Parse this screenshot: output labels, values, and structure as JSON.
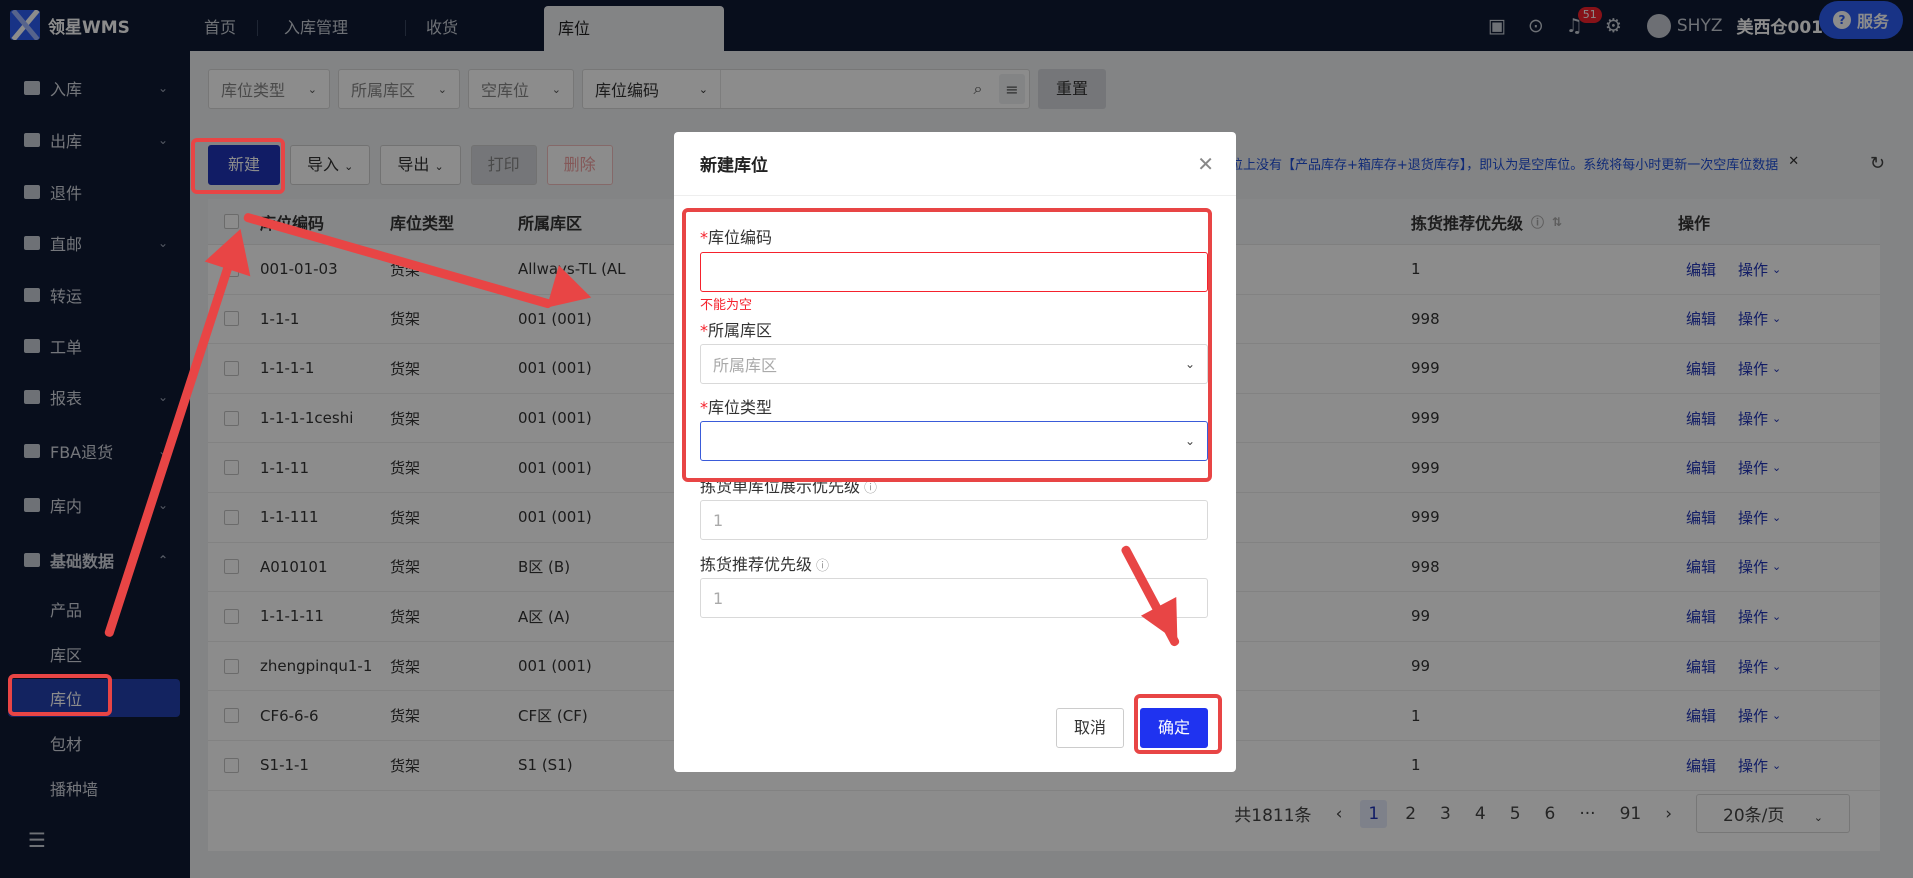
{
  "app": {
    "title": "领星WMS",
    "warehouse": "美西仓001",
    "service": "服务",
    "user": "SHYZ",
    "notifications": "51"
  },
  "tabs": [
    {
      "label": "首页"
    },
    {
      "label": "入库管理"
    },
    {
      "label": "收货"
    },
    {
      "label": "库位"
    }
  ],
  "menu": {
    "inbound": "入库",
    "outbound": "出库",
    "returns": "退件",
    "direct": "直邮",
    "transfer": "转运",
    "workorder": "工单",
    "report": "报表",
    "fba": "FBA退货",
    "internal": "库内",
    "basic": "基础数据",
    "product": "产品",
    "zone": "库区",
    "location": "库位",
    "packing": "包材",
    "wall": "播种墙"
  },
  "filters": {
    "type": "库位类型",
    "zone": "所属库区",
    "empty": "空库位",
    "search_field": "库位编码",
    "search_value": "",
    "reset": "重置"
  },
  "actions": {
    "new": "新建",
    "import": "导入",
    "export": "导出",
    "print": "打印",
    "delete": "删除"
  },
  "notice": "位上没有【产品库存+箱库存+退货库存】，即认为是空库位。系统将每小时更新一次空库位数据",
  "table": {
    "headers": {
      "code": "库位编码",
      "type": "库位类型",
      "zone": "所属库区",
      "priority": "拣货推荐优先级",
      "op": "操作"
    },
    "edit": "编辑",
    "more": "操作",
    "rows": [
      {
        "code": "001-01-03",
        "type": "货架",
        "zone": "Allways-TL (AL",
        "priority": "1"
      },
      {
        "code": "1-1-1",
        "type": "货架",
        "zone": "001 (001)",
        "priority": "998"
      },
      {
        "code": "1-1-1-1",
        "type": "货架",
        "zone": "001 (001)",
        "priority": "999"
      },
      {
        "code": "1-1-1-1ceshi",
        "type": "货架",
        "zone": "001 (001)",
        "priority": "999"
      },
      {
        "code": "1-1-11",
        "type": "货架",
        "zone": "001 (001)",
        "priority": "999"
      },
      {
        "code": "1-1-111",
        "type": "货架",
        "zone": "001 (001)",
        "priority": "999"
      },
      {
        "code": "A010101",
        "type": "货架",
        "zone": "B区 (B)",
        "priority": "998"
      },
      {
        "code": "1-1-1-11",
        "type": "货架",
        "zone": "A区 (A)",
        "priority": "99"
      },
      {
        "code": "zhengpinqu1-1",
        "type": "货架",
        "zone": "001 (001)",
        "priority": "99"
      },
      {
        "code": "CF6-6-6",
        "type": "货架",
        "zone": "CF区 (CF)",
        "priority": "1"
      },
      {
        "code": "S1-1-1",
        "type": "货架",
        "zone": "S1 (S1)",
        "priority": "1"
      }
    ]
  },
  "pagination": {
    "total": "共1811条",
    "pages": [
      "1",
      "2",
      "3",
      "4",
      "5",
      "6",
      "···",
      "91"
    ],
    "page_size": "20条/页"
  },
  "modal": {
    "title": "新建库位",
    "code_label": "库位编码",
    "code_error": "不能为空",
    "zone_label": "所属库区",
    "zone_placeholder": "所属库区",
    "type_label": "库位类型",
    "pick_display_label": "拣货单库位展示优先级",
    "pick_display_value": "1",
    "pick_recommend_label": "拣货推荐优先级",
    "pick_recommend_value": "1",
    "cancel": "取消",
    "ok": "确定"
  },
  "colors": {
    "accent": "#1f33b8",
    "highlight": "#e84545",
    "sidebar": "#101b33"
  }
}
